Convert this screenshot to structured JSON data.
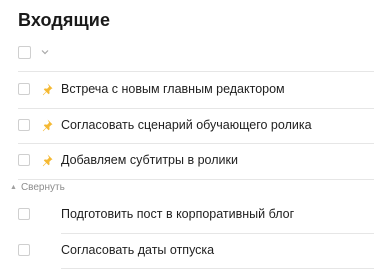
{
  "header": {
    "title": "Входящие"
  },
  "pinned_tasks": [
    {
      "label": "Встреча с новым главным редактором"
    },
    {
      "label": "Согласовать сценарий обучающего ролика"
    },
    {
      "label": "Добавляем субтитры в ролики"
    }
  ],
  "collapse": {
    "label": "Свернуть",
    "icon": "triangle-up-icon"
  },
  "tasks": [
    {
      "label": "Подготовить пост в корпоративный блог"
    },
    {
      "label": "Согласовать даты отпуска"
    }
  ],
  "colors": {
    "pin": "#f5b933",
    "divider": "#e6e6e6",
    "checkbox_border": "#cfcfcf"
  }
}
